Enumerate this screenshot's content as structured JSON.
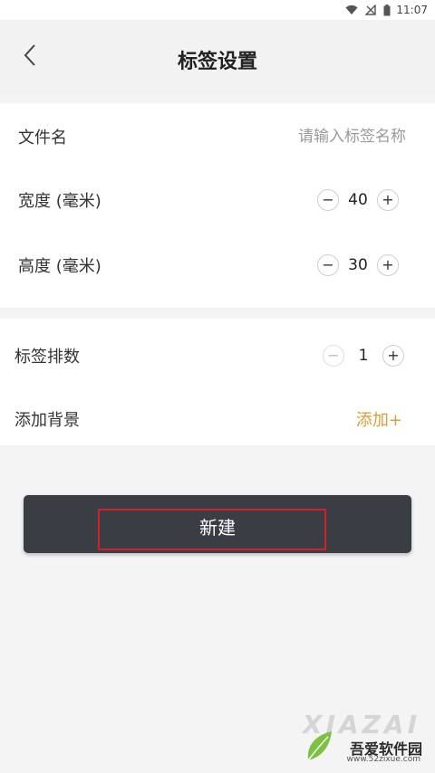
{
  "status_bar": {
    "time": "11:07",
    "icons": [
      "wifi-icon",
      "no-signal-icon",
      "battery-icon"
    ]
  },
  "header": {
    "title": "标签设置",
    "back_icon": "chevron-left-icon"
  },
  "form": {
    "filename": {
      "label": "文件名",
      "placeholder": "请输入标签名称",
      "value": ""
    },
    "width": {
      "label": "宽度 (毫米)",
      "value": "40"
    },
    "height": {
      "label": "高度 (毫米)",
      "value": "30"
    },
    "rows": {
      "label": "标签排数",
      "value": "1"
    },
    "background": {
      "label": "添加背景",
      "action": "添加+"
    }
  },
  "create_button": {
    "label": "新建"
  },
  "watermark": {
    "faint": "XIAZAI",
    "brand": "吾爱软件园",
    "url": "www.52zixue.com"
  },
  "colors": {
    "accent": "#d4a03c",
    "button_bg": "#3a3d44",
    "highlight": "#d0202a",
    "page_bg": "#f4f4f4"
  }
}
